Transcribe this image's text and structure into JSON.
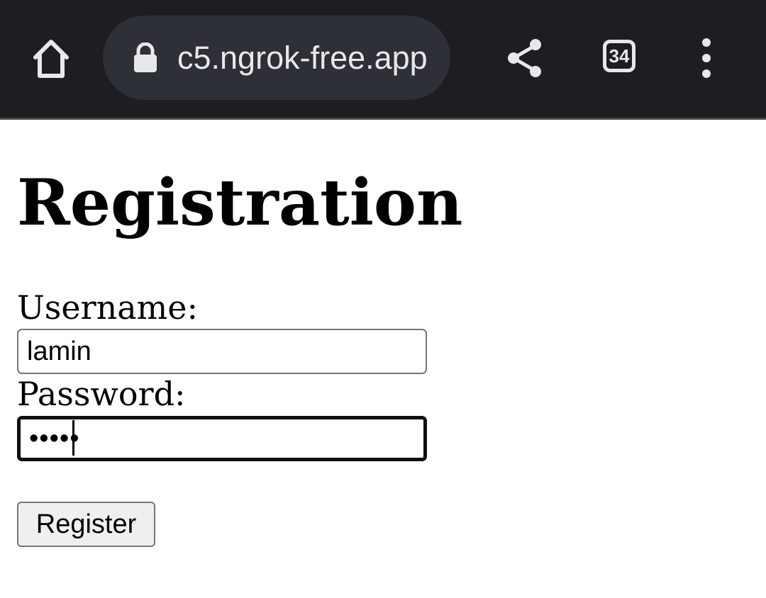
{
  "browser": {
    "url": "c5.ngrok-free.app",
    "tab_count": "34",
    "icons": {
      "home": "home-icon",
      "lock": "lock-icon",
      "share": "share-icon",
      "tabs": "tabs-icon",
      "menu": "more-vert-icon"
    },
    "colors": {
      "toolbar": "#1e1e22",
      "urlbar": "#2e3038",
      "icon": "#e8e8ea"
    }
  },
  "page": {
    "title": "Registration",
    "form": {
      "username_label": "Username:",
      "username_value": "lamin",
      "password_label": "Password:",
      "password_value": "•••••",
      "submit_label": "Register"
    }
  }
}
